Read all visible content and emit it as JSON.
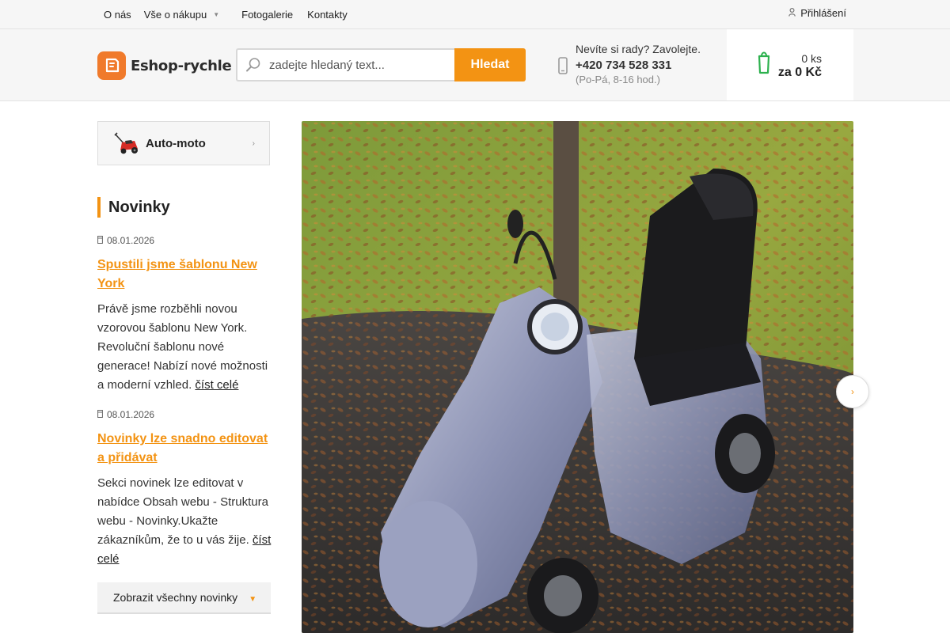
{
  "topnav": {
    "items": [
      {
        "label": "O nás"
      },
      {
        "label": "Vše o nákupu",
        "has_dropdown": true
      },
      {
        "label": "Fotogalerie"
      },
      {
        "label": "Kontakty"
      }
    ],
    "login_label": "Přihlášení"
  },
  "header": {
    "logo_text": "Eshop-rychle",
    "search_placeholder": "zadejte hledaný text...",
    "search_button": "Hledat",
    "contact_question": "Nevíte si rady? Zavolejte.",
    "contact_phone": "+420 734 528 331",
    "contact_hours": "(Po-Pá, 8-16 hod.)",
    "cart_count": "0 ks",
    "cart_total": "za 0 Kč"
  },
  "sidebar": {
    "category_label": "Auto-moto",
    "news_heading": "Novinky",
    "news": [
      {
        "date": "08.01.2026",
        "title": "Spustili jsme šablonu New York",
        "text": "Právě jsme rozběhli novou vzorovou šablonu New York. Revoluční šablonu nové generace! Nabízí nové možnosti a moderní vzhled.",
        "more": "číst celé"
      },
      {
        "date": "08.01.2026",
        "title": "Novinky lze snadno editovat a přidávat",
        "text": "Sekci novinek lze editovat v nabídce Obsah webu - Struktura webu - Novinky.Ukažte zákazníkům, že to u vás žije.",
        "more": "číst celé"
      }
    ],
    "all_news_label": "Zobrazit všechny novinky"
  },
  "colors": {
    "accent": "#f39313",
    "logo": "#f07a2b",
    "cart_icon": "#2db14e"
  },
  "icons": {
    "search": "search-icon",
    "phone": "phone-icon",
    "cart": "cart-icon",
    "user": "user-icon",
    "calendar": "calendar-icon",
    "next": "chevron-right-icon"
  }
}
